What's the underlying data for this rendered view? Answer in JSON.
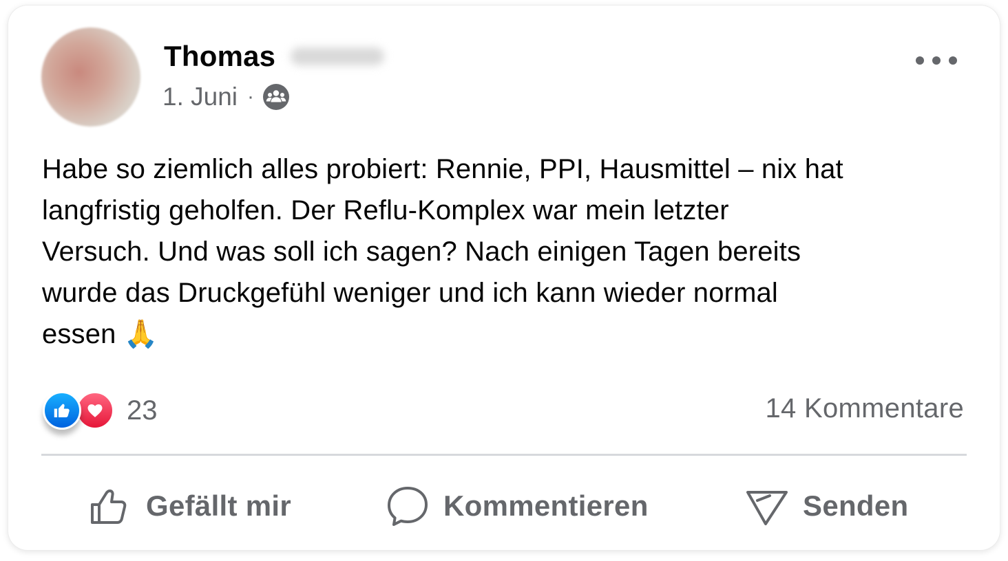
{
  "post": {
    "author": {
      "first_name": "Thomas"
    },
    "date": "1. Juni",
    "separator": "·",
    "audience_icon": "group-audience-icon",
    "text": "Habe so ziemlich alles probiert: Rennie, PPI, Hausmittel – nix hat\nlangfristig geholfen. Der Reflu-Komplex war mein letzter\nVersuch. Und was soll ich sagen? Nach einigen Tagen bereits\nwurde das Druckgefühl weniger und ich kann wieder normal\nessen 🙏",
    "reactions": {
      "types": [
        "like-reaction-icon",
        "love-reaction-icon"
      ],
      "count": "23"
    },
    "comments_label": "14 Kommentare"
  },
  "actions": {
    "like_label": "Gefällt mir",
    "comment_label": "Kommentieren",
    "send_label": "Senden"
  },
  "colors": {
    "text_primary": "#050505",
    "text_secondary": "#65676b",
    "like_blue": "#0866ff",
    "love_red": "#f02849",
    "divider": "#d7d9dc"
  }
}
